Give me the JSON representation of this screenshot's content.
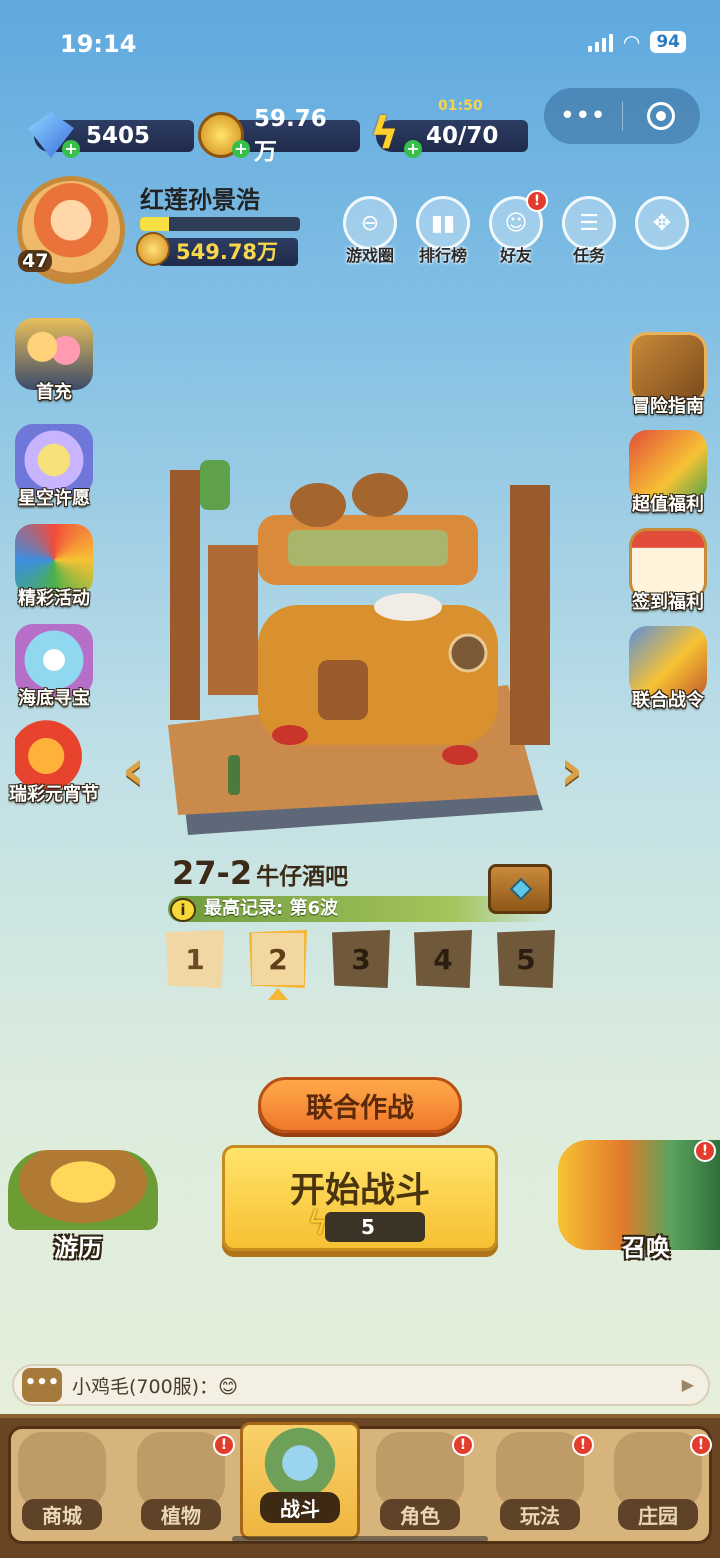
{
  "status": {
    "time": "19:14",
    "battery": "94"
  },
  "currencies": {
    "diamonds": "5405",
    "coins": "59.76万",
    "energy": "40/70",
    "energy_timer": "01:50"
  },
  "player": {
    "name": "红莲孙景浩",
    "level": "47",
    "gold": "549.78万",
    "xp_fraction": 0.18
  },
  "top_icons": [
    {
      "label": "游戏圈",
      "icon": "game-circle-icon"
    },
    {
      "label": "排行榜",
      "icon": "leaderboard-icon"
    },
    {
      "label": "好友",
      "icon": "friends-icon",
      "badge": "!"
    },
    {
      "label": "任务",
      "icon": "tasks-icon"
    },
    {
      "label": "",
      "icon": "more-icon"
    }
  ],
  "left_icons": [
    "首充",
    "星空许愿",
    "精彩活动",
    "海底寻宝",
    "瑞彩元宵节"
  ],
  "right_icons": [
    "冒险指南",
    "超值福利",
    "签到福利",
    "联合战令"
  ],
  "stage": {
    "number": "27-2",
    "name": "牛仔酒吧",
    "record": "最高记录: 第6波",
    "waves": [
      "1",
      "2",
      "3",
      "4",
      "5"
    ],
    "current_wave": 2
  },
  "buttons": {
    "coop": "联合作战",
    "start": "开始战斗",
    "energy_cost": "5",
    "travel": "游历",
    "summon": "召唤"
  },
  "chat": {
    "message": "小鸡毛(700服)：😊"
  },
  "nav": [
    {
      "label": "商城",
      "badge": false
    },
    {
      "label": "植物",
      "badge": true
    },
    {
      "label": "战斗",
      "badge": false,
      "active": true
    },
    {
      "label": "角色",
      "badge": true
    },
    {
      "label": "玩法",
      "badge": true
    },
    {
      "label": "庄园",
      "badge": true
    }
  ],
  "colors": {
    "accent": "#f7c033",
    "alert": "#e23c2c",
    "nav_bg": "#6a4524"
  }
}
